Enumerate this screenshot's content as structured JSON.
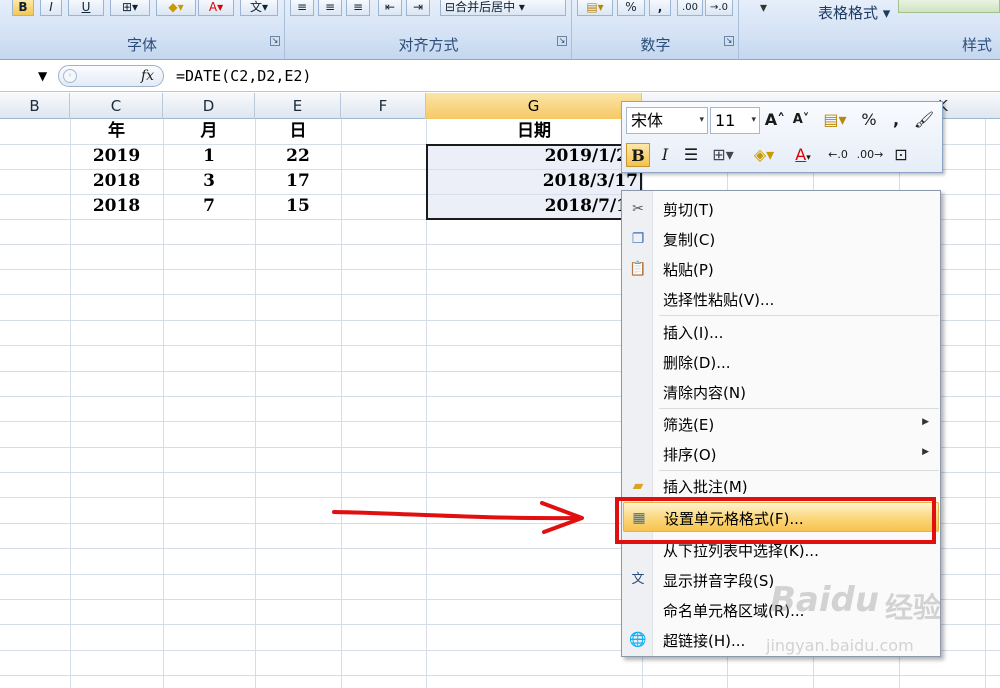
{
  "ribbon": {
    "groups": [
      {
        "label": "字体"
      },
      {
        "label": "对齐方式"
      },
      {
        "label": "数字"
      },
      {
        "label": "样式"
      }
    ],
    "buttons": {
      "bold": "B",
      "italic": "I",
      "underline": "U",
      "percent": "%",
      "comma": ",",
      "merge_center": "合并后居中",
      "table_format": "表格格式"
    }
  },
  "formula_bar": {
    "fx": "fx",
    "formula": "=DATE(C2,D2,E2)"
  },
  "columns": [
    "B",
    "C",
    "D",
    "E",
    "F",
    "G",
    "K"
  ],
  "rows": [
    {
      "c": "年",
      "d": "月",
      "e": "日",
      "g": "日期"
    },
    {
      "c": "2019",
      "d": "1",
      "e": "22",
      "g": "2019/1/2"
    },
    {
      "c": "2018",
      "d": "3",
      "e": "17",
      "g": "2018/3/17"
    },
    {
      "c": "2018",
      "d": "7",
      "e": "15",
      "g": "2018/7/1"
    }
  ],
  "mini_toolbar": {
    "font_name": "宋体",
    "font_size": "11",
    "bold": "B",
    "italic": "I",
    "percent": "%",
    "comma": ","
  },
  "context_menu": {
    "items": [
      {
        "label": "剪切(T)",
        "icon": "scissors-icon"
      },
      {
        "label": "复制(C)",
        "icon": "copy-icon"
      },
      {
        "label": "粘贴(P)",
        "icon": "paste-icon"
      },
      {
        "label": "选择性粘贴(V)..."
      },
      {
        "label": "插入(I)..."
      },
      {
        "label": "删除(D)..."
      },
      {
        "label": "清除内容(N)"
      },
      {
        "label": "筛选(E)",
        "submenu": true
      },
      {
        "label": "排序(O)",
        "submenu": true
      },
      {
        "label": "插入批注(M)",
        "icon": "comment-icon"
      },
      {
        "label": "设置单元格格式(F)...",
        "icon": "format-cells-icon",
        "highlighted": true
      },
      {
        "label": "从下拉列表中选择(K)..."
      },
      {
        "label": "显示拼音字段(S)",
        "icon": "pinyin-icon"
      },
      {
        "label": "命名单元格区域(R)..."
      },
      {
        "label": "超链接(H)...",
        "icon": "hyperlink-icon"
      }
    ]
  },
  "annotation": {
    "highlight_color": "#e01010"
  },
  "watermark": {
    "brand": "Baidu",
    "name": "经验",
    "url": "jingyan.baidu.com"
  }
}
